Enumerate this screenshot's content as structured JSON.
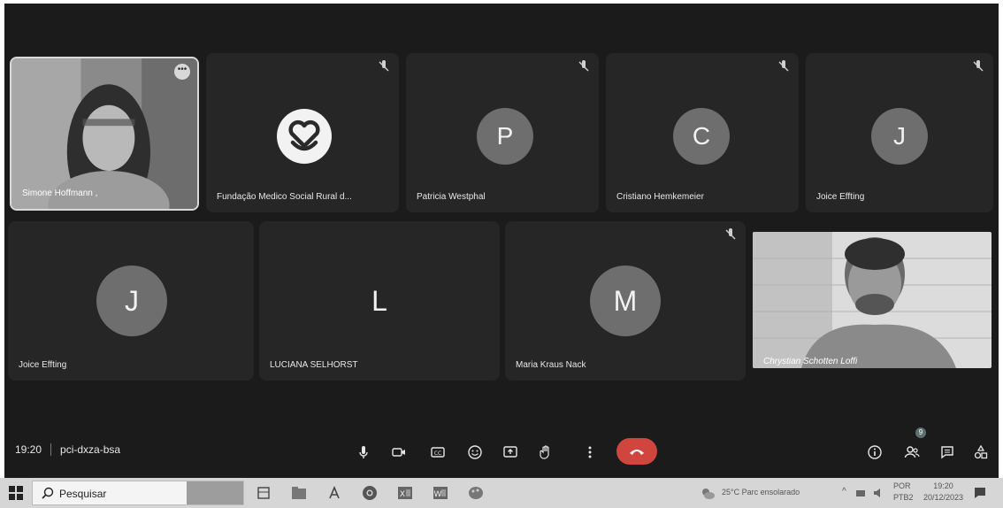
{
  "participants_row1": [
    {
      "name": "Simone Hoffmann ,"
    },
    {
      "name": "Fundação Medico Social Rural d..."
    },
    {
      "name": "Patricia Westphal",
      "initial": "P"
    },
    {
      "name": "Cristiano Hemkemeier",
      "initial": "C"
    },
    {
      "name": "Joice Effting",
      "initial": "J"
    }
  ],
  "participants_row2": [
    {
      "name": "Joice Effting",
      "initial": "J"
    },
    {
      "name": "LUCIANA SELHORST",
      "initial": "L"
    },
    {
      "name": "Maria Kraus Nack",
      "initial": "M"
    },
    {
      "name": "Chrystian Schotten Loffi"
    }
  ],
  "meeting": {
    "time": "19:20",
    "code": "pci-dxza-bsa"
  },
  "people_badge": "9",
  "taskbar": {
    "search_placeholder": "Pesquisar",
    "weather": "25°C  Parc ensolarado",
    "lang_top": "POR",
    "lang_bottom": "PTB2",
    "clock_time": "19:20",
    "clock_date": "20/12/2023"
  },
  "colors": {
    "avatar": "#6e6e6e",
    "tile": "#262626",
    "background": "#1b1b1b",
    "end_call": "#d0463e"
  }
}
